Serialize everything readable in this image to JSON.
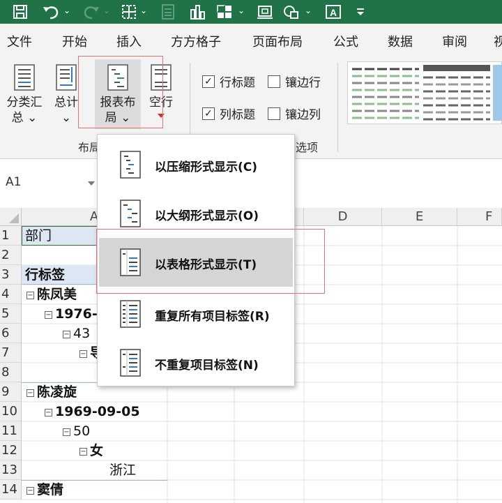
{
  "tabs": [
    "文件",
    "开始",
    "插入",
    "方方格子",
    "页面布局",
    "公式",
    "数据",
    "审阅",
    "视"
  ],
  "ribbon": {
    "subtotals": {
      "line1": "分类汇",
      "line2": "总 ⌄"
    },
    "grand_totals": {
      "line1": "总计",
      "line2": "⌄"
    },
    "report_layout": {
      "line1": "报表布",
      "line2": "局 ⌄"
    },
    "blank_rows": {
      "line1": "空行"
    },
    "layout_group_label": "布局",
    "options_group_label": "选项",
    "row_headers": {
      "label": "行标题",
      "checked": true
    },
    "column_headers": {
      "label": "列标题",
      "checked": true
    },
    "banded_rows": {
      "label": "镶边行",
      "checked": false
    },
    "banded_columns": {
      "label": "镶边列",
      "checked": false
    }
  },
  "name_box": {
    "value": "A1"
  },
  "columns": [
    "A",
    "D",
    "E",
    "F"
  ],
  "rows": [
    "1",
    "2",
    "3",
    "4",
    "5",
    "6",
    "7",
    "8",
    "9",
    "10",
    "11",
    "12",
    "13",
    "14"
  ],
  "cells": {
    "r1": "部门",
    "r3": "行标签",
    "r4": "陈凤美",
    "r5": "1976-",
    "r6": "43",
    "r7": "导",
    "r9": "陈凌旋",
    "r10": "1969-09-05",
    "r11": "50",
    "r12": "女",
    "r13": "浙江",
    "r14": "窦倩"
  },
  "menu": {
    "items": [
      {
        "label": "以压缩形式显示(C)"
      },
      {
        "label": "以大纲形式显示(O)"
      },
      {
        "label": "以表格形式显示(T)"
      },
      {
        "label": "重复所有项目标签(R)"
      },
      {
        "label": "不重复项目标签(N)"
      }
    ],
    "highlighted_index": 2
  },
  "colors": {
    "title_bar": "#207346",
    "highlight": "#d5d5d5",
    "annotation": "#e57373"
  }
}
